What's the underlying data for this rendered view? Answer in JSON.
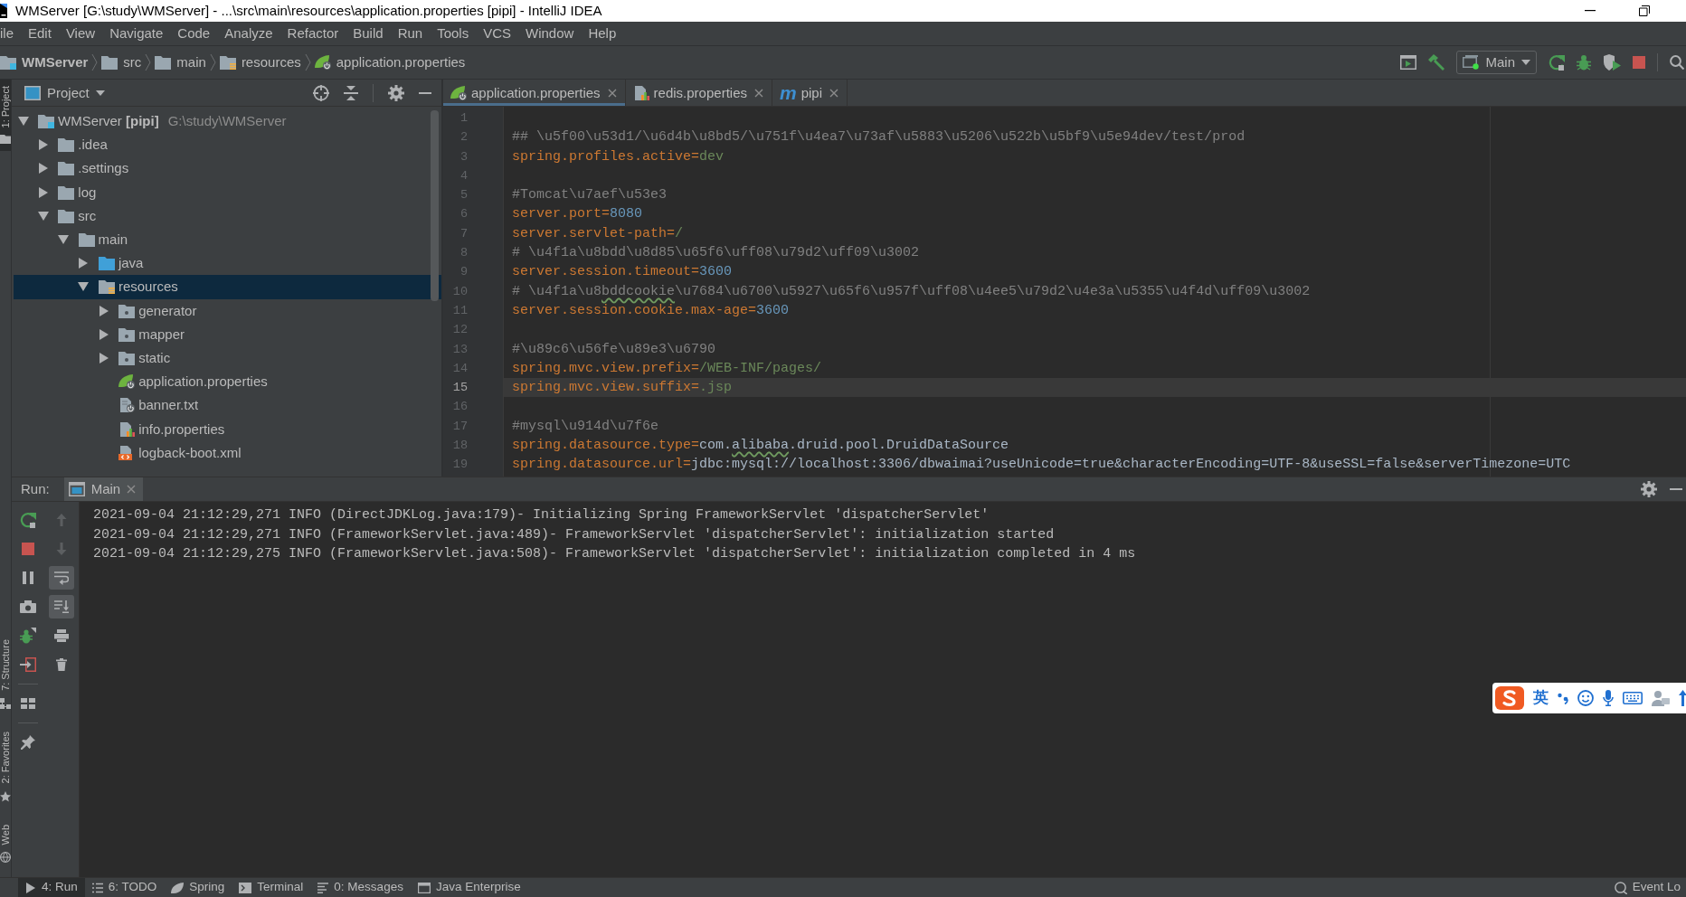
{
  "window": {
    "title": "WMServer [G:\\study\\WMServer] - ...\\src\\main\\resources\\application.properties [pipi] - IntelliJ IDEA"
  },
  "menu": [
    "ile",
    "Edit",
    "View",
    "Navigate",
    "Code",
    "Analyze",
    "Refactor",
    "Build",
    "Run",
    "Tools",
    "VCS",
    "Window",
    "Help"
  ],
  "navigation_bar": {
    "breadcrumb": [
      {
        "label": "WMServer",
        "kind": "module"
      },
      {
        "label": "src",
        "kind": "folder"
      },
      {
        "label": "main",
        "kind": "folder"
      },
      {
        "label": "resources",
        "kind": "resources-folder"
      },
      {
        "label": "application.properties",
        "kind": "spring-config"
      }
    ],
    "run_configuration": "Main"
  },
  "left_stripe": {
    "top": [
      {
        "label": "1: Project",
        "kind": "project",
        "selected": true
      }
    ],
    "bottom": [
      {
        "label": "7: Structure",
        "kind": "structure",
        "selected": false
      },
      {
        "label": "2: Favorites",
        "kind": "favorites",
        "selected": false
      },
      {
        "label": "Web",
        "kind": "web",
        "selected": false
      }
    ]
  },
  "project_panel": {
    "title": "Project",
    "tree": [
      {
        "label": "WMServer **[pipi]**",
        "location": "G:\\study\\WMServer",
        "kind": "module",
        "expanded": true,
        "selected": false,
        "children": [
          {
            "label": ".idea",
            "kind": "folder",
            "expanded": false,
            "selected": false
          },
          {
            "label": ".settings",
            "kind": "folder",
            "expanded": false,
            "selected": false
          },
          {
            "label": "log",
            "kind": "folder",
            "expanded": false,
            "selected": false
          },
          {
            "label": "src",
            "kind": "folder",
            "expanded": true,
            "selected": false,
            "children": [
              {
                "label": "main",
                "kind": "folder",
                "expanded": true,
                "selected": false,
                "children": [
                  {
                    "label": "java",
                    "kind": "source-folder",
                    "expanded": false,
                    "selected": false
                  },
                  {
                    "label": "resources",
                    "kind": "resources-folder",
                    "expanded": true,
                    "selected": true,
                    "children": [
                      {
                        "label": "generator",
                        "kind": "package",
                        "expanded": false,
                        "selected": false
                      },
                      {
                        "label": "mapper",
                        "kind": "package",
                        "expanded": false,
                        "selected": false
                      },
                      {
                        "label": "static",
                        "kind": "package",
                        "expanded": false,
                        "selected": false
                      },
                      {
                        "label": "application.properties",
                        "kind": "spring-config",
                        "selected": false
                      },
                      {
                        "label": "banner.txt",
                        "kind": "spring-text",
                        "selected": false
                      },
                      {
                        "label": "info.properties",
                        "kind": "properties",
                        "selected": false
                      },
                      {
                        "label": "logback-boot.xml",
                        "kind": "xml",
                        "selected": false
                      }
                    ]
                  }
                ]
              }
            ]
          }
        ]
      }
    ]
  },
  "editor": {
    "tabs": [
      {
        "label": "application.properties",
        "kind": "spring-config",
        "selected": true
      },
      {
        "label": "redis.properties",
        "kind": "properties",
        "selected": false
      },
      {
        "label": "pipi",
        "kind": "letter",
        "glyph": "m",
        "selected": false
      }
    ],
    "lines": [
      {
        "number": "1",
        "current": false
      },
      {
        "number": "2",
        "current": false,
        "segments": [
          {
            "kind": "comment",
            "text": "## \\u5f00\\u53d1/\\u6d4b\\u8bd5/\\u751f\\u4ea7\\u73af\\u5883\\u5206\\u522b\\u5bf9\\u5e94dev/test/prod",
            "misspelled": false
          }
        ]
      },
      {
        "number": "3",
        "current": false,
        "segments": [
          {
            "kind": "key",
            "text": "spring.profiles.active=",
            "misspelled": false
          },
          {
            "kind": "value",
            "text": "dev",
            "misspelled": false
          }
        ]
      },
      {
        "number": "4",
        "current": false
      },
      {
        "number": "5",
        "current": false,
        "segments": [
          {
            "kind": "comment",
            "text": "#Tomcat\\u7aef\\u53e3",
            "misspelled": false
          }
        ]
      },
      {
        "number": "6",
        "current": false,
        "segments": [
          {
            "kind": "key",
            "text": "server.port=",
            "misspelled": false
          },
          {
            "kind": "number",
            "text": "8080",
            "misspelled": false
          }
        ]
      },
      {
        "number": "7",
        "current": false,
        "segments": [
          {
            "kind": "key",
            "text": "server.servlet-path=",
            "misspelled": false
          },
          {
            "kind": "value",
            "text": "/",
            "misspelled": false
          }
        ]
      },
      {
        "number": "8",
        "current": false,
        "segments": [
          {
            "kind": "comment",
            "text": "# \\u4f1a\\u8bdd\\u8d85\\u65f6\\uff08\\u79d2\\uff09\\u3002",
            "misspelled": false
          }
        ]
      },
      {
        "number": "9",
        "current": false,
        "segments": [
          {
            "kind": "key",
            "text": "server.session.timeout=",
            "misspelled": false
          },
          {
            "kind": "number",
            "text": "3600",
            "misspelled": false
          }
        ]
      },
      {
        "number": "10",
        "current": false,
        "segments": [
          {
            "kind": "comment",
            "text": "# \\u4f1a\\u8",
            "misspelled": false
          },
          {
            "kind": "comment",
            "text": "bddcookie",
            "misspelled": true
          },
          {
            "kind": "comment",
            "text": "\\u7684\\u6700\\u5927\\u65f6\\u957f\\uff08\\u4ee5\\u79d2\\u4e3a\\u5355\\u4f4d\\uff09\\u3002",
            "misspelled": false
          }
        ]
      },
      {
        "number": "11",
        "current": false,
        "segments": [
          {
            "kind": "key",
            "text": "server.session.cookie.max-age=",
            "misspelled": false
          },
          {
            "kind": "number",
            "text": "3600",
            "misspelled": false
          }
        ]
      },
      {
        "number": "12",
        "current": false
      },
      {
        "number": "13",
        "current": false,
        "segments": [
          {
            "kind": "comment",
            "text": "#\\u89c6\\u56fe\\u89e3\\u6790",
            "misspelled": false
          }
        ]
      },
      {
        "number": "14",
        "current": false,
        "segments": [
          {
            "kind": "key",
            "text": "spring.mvc.view.prefix=",
            "misspelled": false
          },
          {
            "kind": "value",
            "text": "/WEB-INF/pages/",
            "misspelled": false
          }
        ]
      },
      {
        "number": "15",
        "current": true,
        "segments": [
          {
            "kind": "key",
            "text": "spring.mvc.view.suffix=",
            "misspelled": false
          },
          {
            "kind": "value",
            "text": ".jsp",
            "misspelled": false
          }
        ]
      },
      {
        "number": "16",
        "current": false
      },
      {
        "number": "17",
        "current": false,
        "segments": [
          {
            "kind": "comment",
            "text": "#mysql\\u914d\\u7f6e",
            "misspelled": false
          }
        ]
      },
      {
        "number": "18",
        "current": false,
        "segments": [
          {
            "kind": "key",
            "text": "spring.datasource.type=",
            "misspelled": false
          },
          {
            "kind": "plain",
            "text": "com.",
            "misspelled": false
          },
          {
            "kind": "plain",
            "text": "alibaba",
            "misspelled": true
          },
          {
            "kind": "plain",
            "text": ".druid.pool.DruidDataSource",
            "misspelled": false
          }
        ]
      },
      {
        "number": "19",
        "current": false,
        "segments": [
          {
            "kind": "key",
            "text": "spring.datasource.url=",
            "misspelled": false
          },
          {
            "kind": "plain",
            "text": "jdbc:mysql://localhost:3306/dbwaimai?useUnicode=true&characterEncoding=UTF-8&useSSL=false&serverTimezone=UTC",
            "misspelled": false
          }
        ]
      }
    ]
  },
  "run_panel": {
    "label": "Run:",
    "tabs": [
      {
        "label": "Main",
        "selected": true
      }
    ],
    "toolbar": [
      {
        "disabled": true,
        "on": false
      },
      {
        "disabled": true,
        "on": false
      },
      {
        "disabled": false,
        "on": true
      },
      {
        "disabled": false,
        "on": true
      },
      {
        "disabled": false,
        "on": false
      },
      {
        "disabled": false,
        "on": false
      }
    ],
    "console": [
      "2021-09-04 21:12:29,271 INFO (DirectJDKLog.java:179)- Initializing Spring FrameworkServlet 'dispatcherServlet'",
      "2021-09-04 21:12:29,271 INFO (FrameworkServlet.java:489)- FrameworkServlet 'dispatcherServlet': initialization started",
      "2021-09-04 21:12:29,275 INFO (FrameworkServlet.java:508)- FrameworkServlet 'dispatcherServlet': initialization completed in 4 ms"
    ]
  },
  "bottom_bar": {
    "tools": [
      {
        "label": "4: Run",
        "kind": "run",
        "selected": true
      },
      {
        "label": "6: TODO",
        "kind": "todo",
        "selected": false
      },
      {
        "label": "Spring",
        "kind": "spring",
        "selected": false
      },
      {
        "label": "Terminal",
        "kind": "terminal",
        "selected": false
      },
      {
        "label": "0: Messages",
        "kind": "messages",
        "selected": false
      },
      {
        "label": "Java Enterprise",
        "kind": "java-enterprise",
        "selected": false
      }
    ],
    "event_log": "Event Lo"
  },
  "input_method": {
    "mode": "英"
  }
}
